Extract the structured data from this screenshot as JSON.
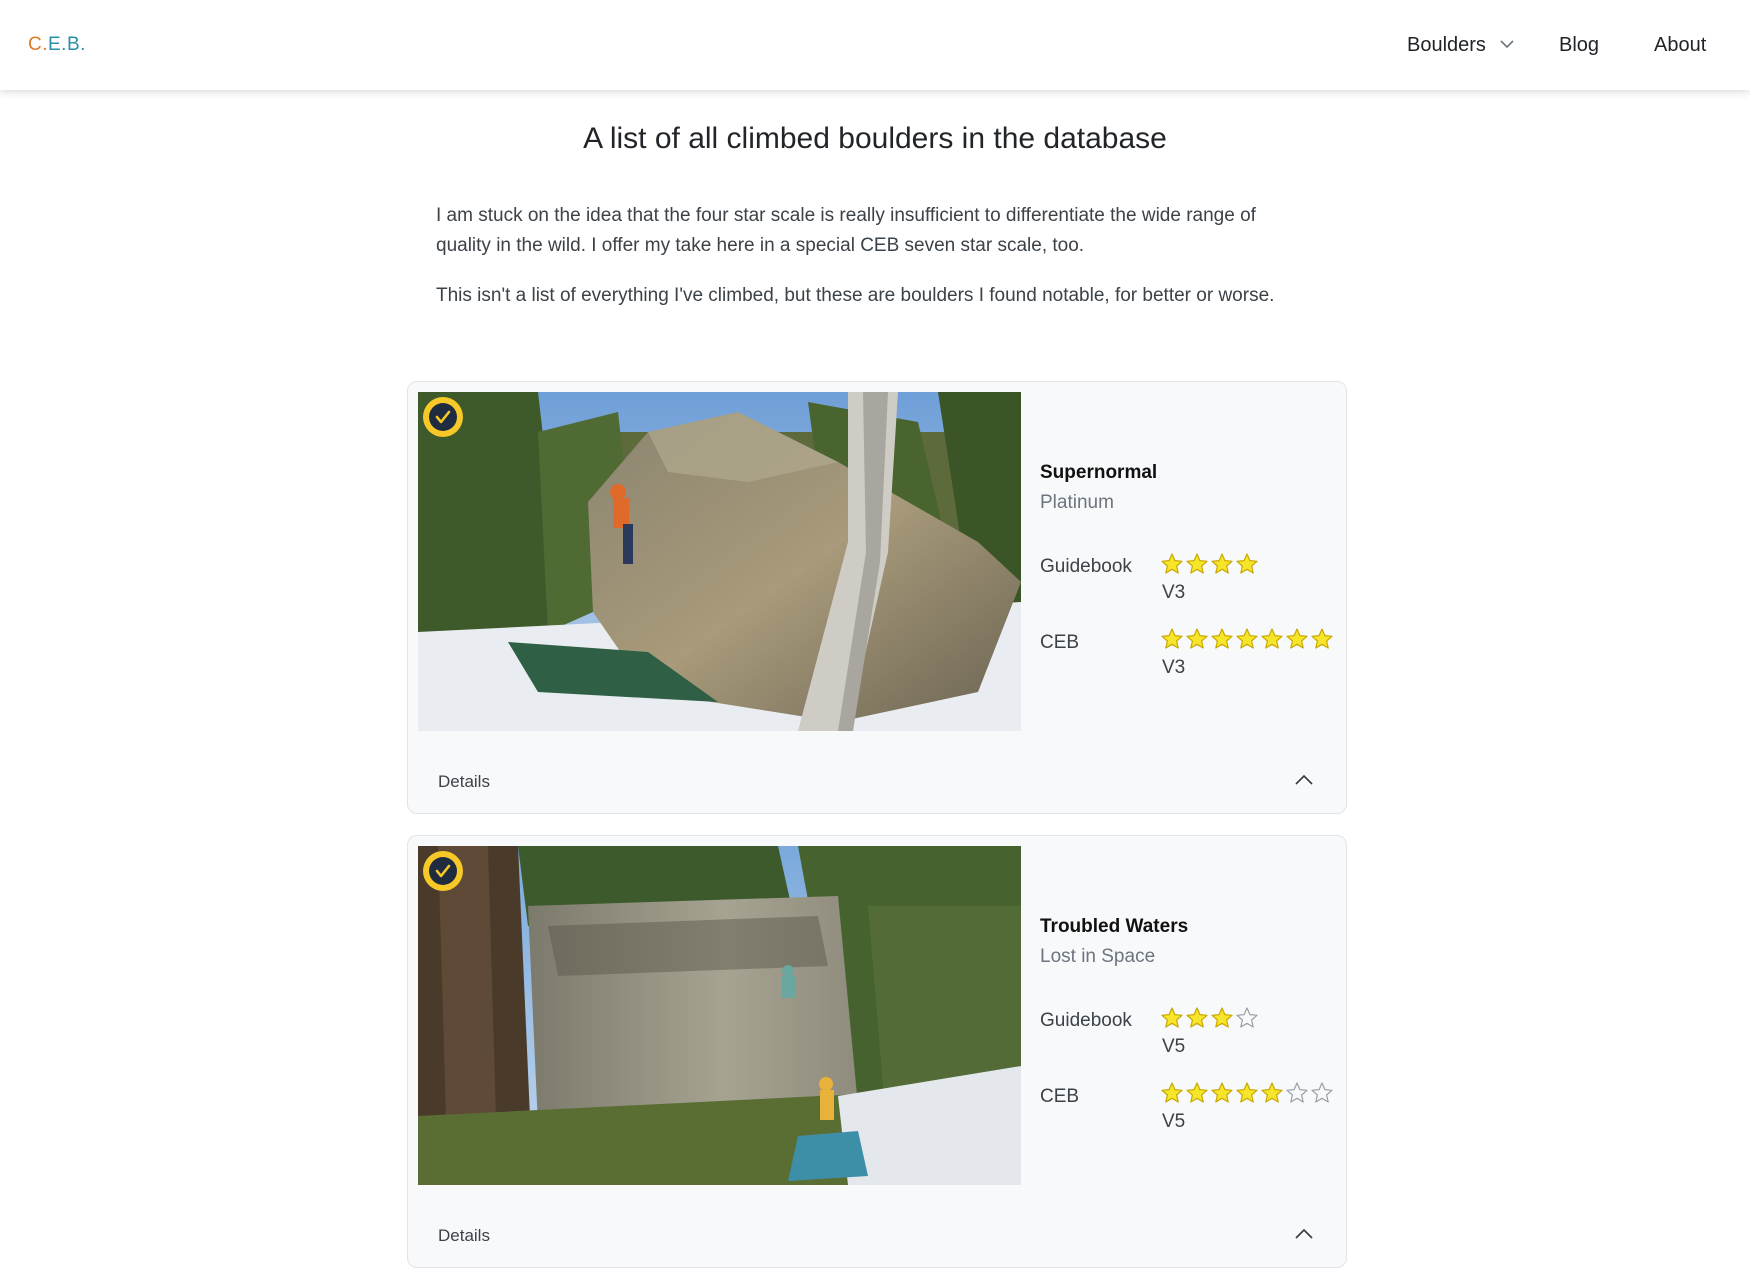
{
  "nav": {
    "brand": "C.E.B.",
    "items": [
      "Boulders",
      "Blog",
      "About"
    ]
  },
  "page": {
    "title": "A list of all climbed boulders in the database",
    "intro": [
      "I am stuck on the idea that the four star scale is really insufficient to differentiate the wide range of quality in the wild. I offer my take here in a special CEB seven star scale, too.",
      "This isn't a list of everything I've climbed, but these are boulders I found notable, for better or worse."
    ]
  },
  "boulders": [
    {
      "name": "Supernormal",
      "area": "Platinum",
      "guidebook_label": "Guidebook",
      "guidebook_stars": 4,
      "guidebook_max": 4,
      "guidebook_grade": "V3",
      "ceb_label": "CEB",
      "ceb_stars": 7,
      "ceb_max": 7,
      "ceb_grade": "V3",
      "details_label": "Details",
      "climbed_icon": "check-badge-icon"
    },
    {
      "name": "Troubled Waters",
      "area": "Lost in Space",
      "guidebook_label": "Guidebook",
      "guidebook_stars": 3,
      "guidebook_max": 4,
      "guidebook_grade": "V5",
      "ceb_label": "CEB",
      "ceb_stars": 5,
      "ceb_max": 7,
      "ceb_grade": "V5",
      "details_label": "Details",
      "climbed_icon": "check-badge-icon"
    }
  ],
  "colors": {
    "star_fill": "#f7e52a",
    "star_stroke": "#c9a800",
    "badge": "#f6c928",
    "brand_orange": "#e07b24",
    "brand_teal": "#2a8fa6"
  }
}
